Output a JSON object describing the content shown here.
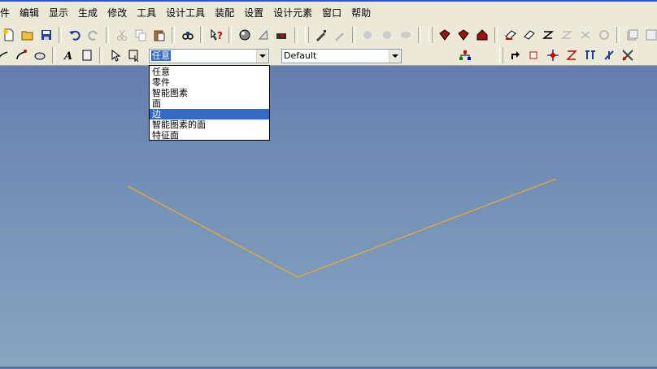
{
  "menu": [
    "件",
    "编辑",
    "显示",
    "生成",
    "修改",
    "工具",
    "设计工具",
    "装配",
    "设置",
    "设计元素",
    "窗口",
    "帮助"
  ],
  "toolbar": {
    "filter_combo": {
      "value": "任意",
      "options": [
        "任意",
        "零件",
        "智能图素",
        "面",
        "边",
        "智能图素的面",
        "特征面"
      ],
      "selected_index": 4
    },
    "style_combo": {
      "value": "Default"
    }
  },
  "colors": {
    "accent": "#316ac5",
    "viewport_edge": "#e8a830",
    "toolbar_bg": "#ece9d8"
  }
}
